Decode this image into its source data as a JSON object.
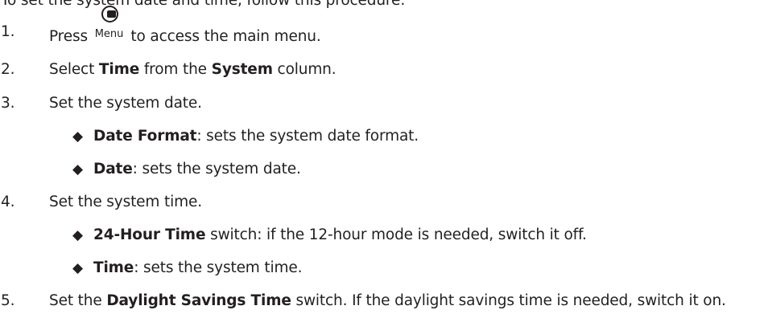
{
  "intro": "To set the system date and time, follow this procedure:",
  "steps": [
    {
      "num": "1.",
      "pre": "Press",
      "key_label": "Menu",
      "post": "to access the main menu."
    },
    {
      "num": "2.",
      "pre": "Select ",
      "bold1": "Time",
      "mid": " from the ",
      "bold2": "System",
      "post": " column."
    },
    {
      "num": "3.",
      "text": "Set the system date.",
      "bullets": [
        {
          "bullet": "◆",
          "bold": "Date Format",
          "text": ": sets the system date format."
        },
        {
          "bullet": "◆",
          "bold": "Date",
          "text": ": sets the system date."
        }
      ]
    },
    {
      "num": "4.",
      "text": "Set the system time.",
      "bullets": [
        {
          "bullet": "◆",
          "bold": "24-Hour Time",
          "text": " switch: if the 12-hour mode is needed, switch it off."
        },
        {
          "bullet": "◆",
          "bold": "Time",
          "text": ": sets the system time."
        }
      ]
    },
    {
      "num": "5.",
      "pre": "Set the ",
      "bold": "Daylight Savings Time",
      "post": " switch. If the daylight savings time is needed, switch it on."
    }
  ]
}
